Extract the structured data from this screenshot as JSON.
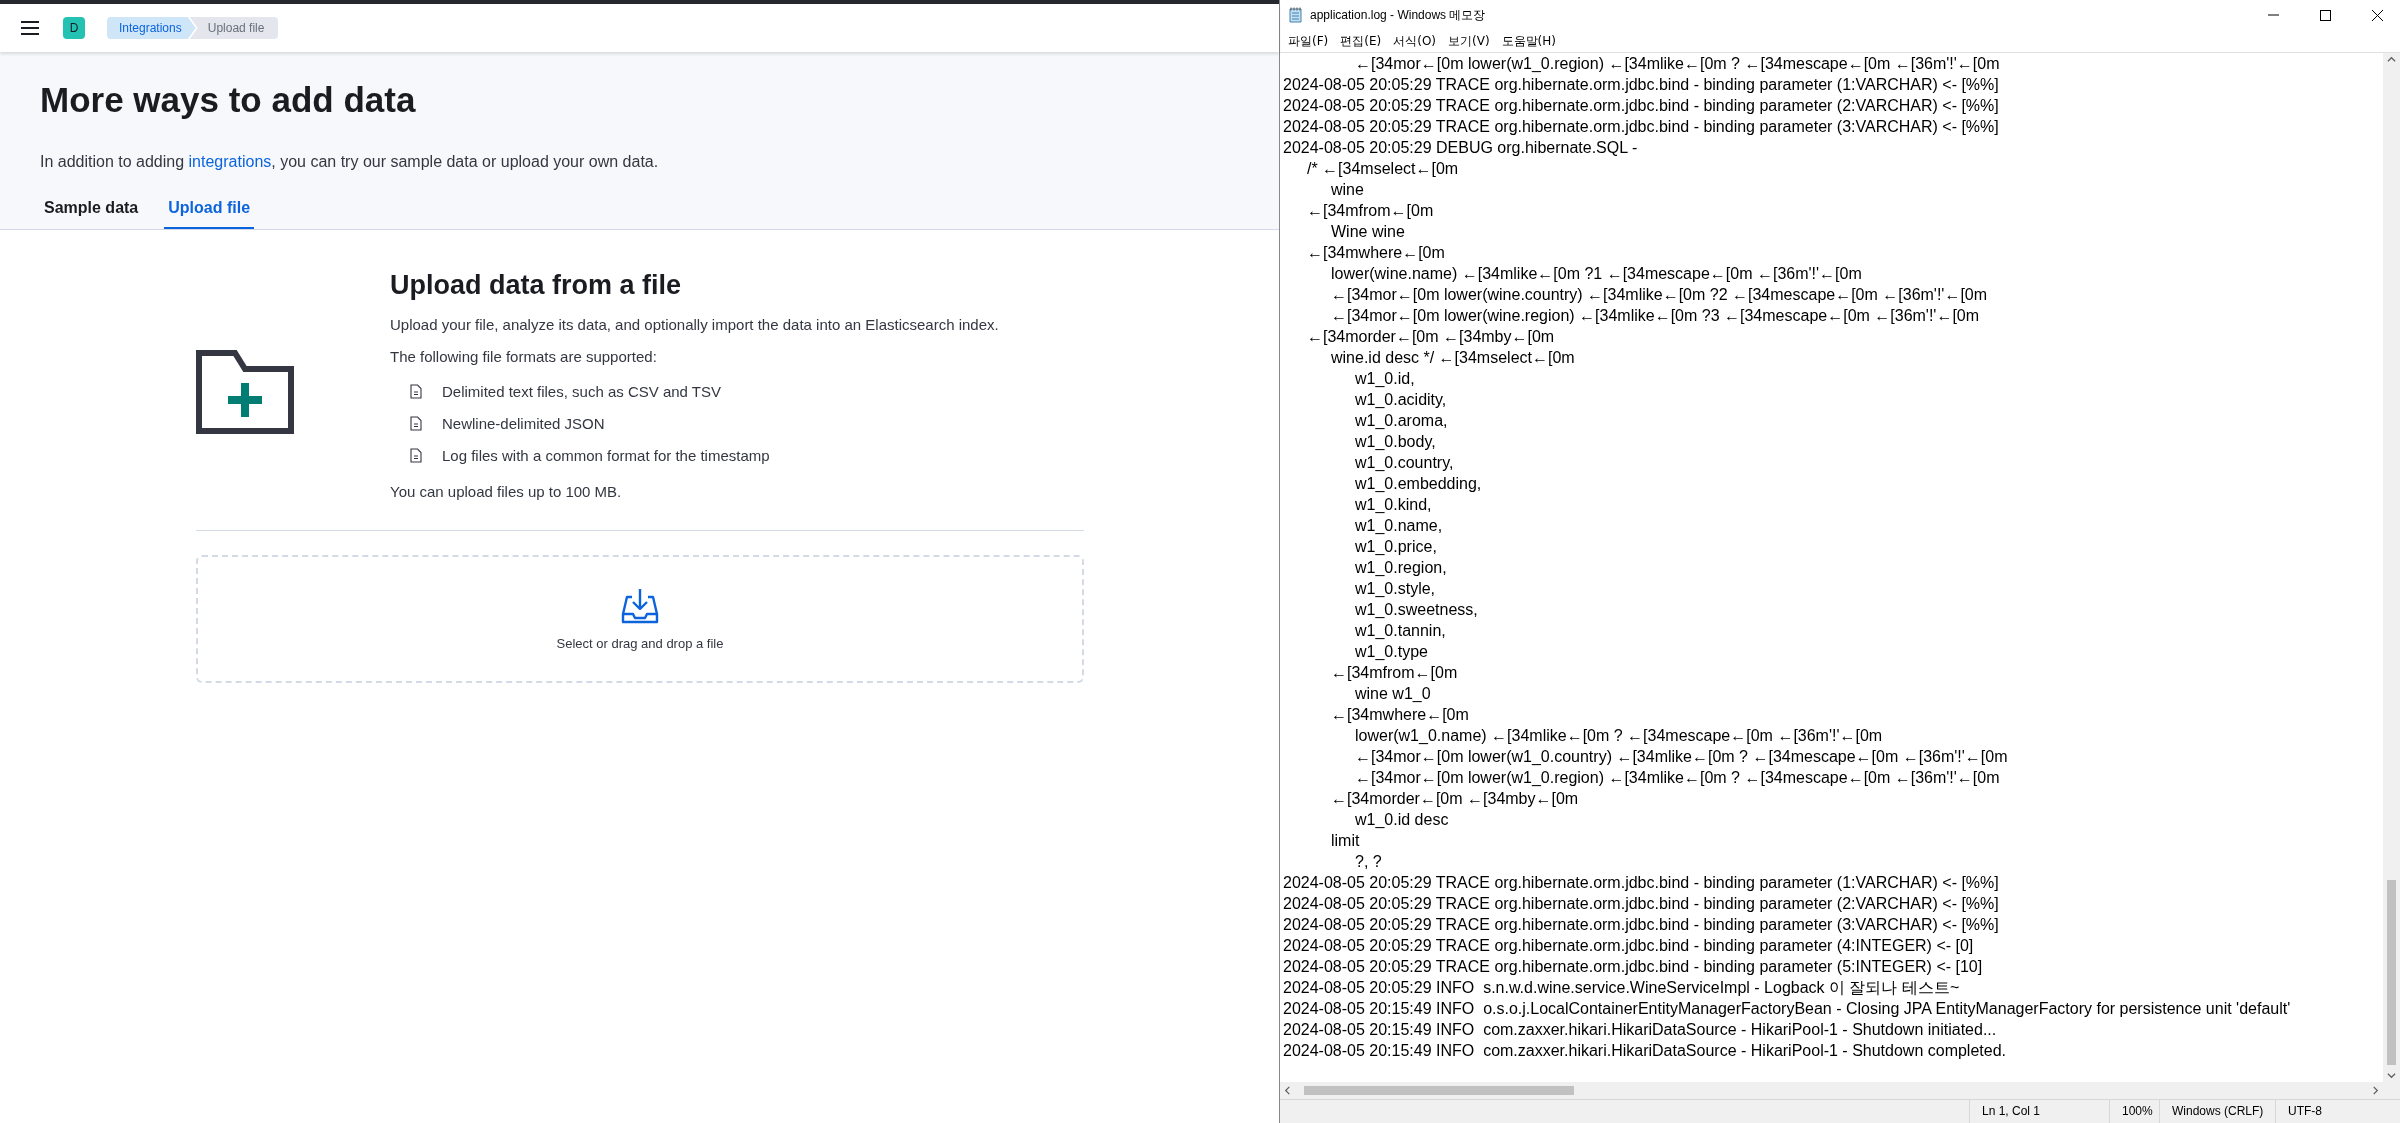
{
  "kibana": {
    "header": {
      "avatar": "D",
      "breadcrumbs": [
        {
          "label": "Integrations",
          "selected": false
        },
        {
          "label": "Upload file",
          "selected": true
        }
      ]
    },
    "page": {
      "title": "More ways to add data",
      "description": {
        "before": "In addition to adding ",
        "link": "integrations",
        "after": ", you can try our sample data or upload your own data."
      },
      "tabs": [
        {
          "label": "Sample data",
          "selected": false
        },
        {
          "label": "Upload file",
          "selected": true
        }
      ]
    },
    "upload": {
      "title": "Upload data from a file",
      "description": "Upload your file, analyze its data, and optionally import the data into an Elasticsearch index.",
      "formats_intro": "The following file formats are supported:",
      "formats": [
        "Delimited text files, such as CSV and TSV",
        "Newline-delimited JSON",
        "Log files with a common format for the timestamp"
      ],
      "limit": "You can upload files up to 100 MB.",
      "dropzone": "Select or drag and drop a file"
    }
  },
  "notepad": {
    "title": "application.log - Windows 메모장",
    "menu": [
      "파일(F)",
      "편집(E)",
      "서식(O)",
      "보기(V)",
      "도움말(H)"
    ],
    "lines": [
      "\t\t\t←[34mor←[0m lower(w1_0.region) ←[34mlike←[0m ? ←[34mescape←[0m ←[36m'!'←[0m",
      "2024-08-05 20:05:29 TRACE org.hibernate.orm.jdbc.bind - binding parameter (1:VARCHAR) <- [%%]",
      "2024-08-05 20:05:29 TRACE org.hibernate.orm.jdbc.bind - binding parameter (2:VARCHAR) <- [%%]",
      "2024-08-05 20:05:29 TRACE org.hibernate.orm.jdbc.bind - binding parameter (3:VARCHAR) <- [%%]",
      "2024-08-05 20:05:29 DEBUG org.hibernate.SQL -",
      "\t/* ←[34mselect←[0m",
      "\t\twine",
      "\t←[34mfrom←[0m",
      "\t\tWine wine",
      "\t←[34mwhere←[0m",
      "\t\tlower(wine.name) ←[34mlike←[0m ?1 ←[34mescape←[0m ←[36m'!'←[0m",
      "\t\t←[34mor←[0m lower(wine.country) ←[34mlike←[0m ?2 ←[34mescape←[0m ←[36m'!'←[0m",
      "\t\t←[34mor←[0m lower(wine.region) ←[34mlike←[0m ?3 ←[34mescape←[0m ←[36m'!'←[0m",
      "\t←[34morder←[0m ←[34mby←[0m",
      "\t\twine.id desc */ ←[34mselect←[0m",
      "\t\t\tw1_0.id,",
      "\t\t\tw1_0.acidity,",
      "\t\t\tw1_0.aroma,",
      "\t\t\tw1_0.body,",
      "\t\t\tw1_0.country,",
      "\t\t\tw1_0.embedding,",
      "\t\t\tw1_0.kind,",
      "\t\t\tw1_0.name,",
      "\t\t\tw1_0.price,",
      "\t\t\tw1_0.region,",
      "\t\t\tw1_0.style,",
      "\t\t\tw1_0.sweetness,",
      "\t\t\tw1_0.tannin,",
      "\t\t\tw1_0.type",
      "\t\t←[34mfrom←[0m",
      "\t\t\twine w1_0",
      "\t\t←[34mwhere←[0m",
      "\t\t\tlower(w1_0.name) ←[34mlike←[0m ? ←[34mescape←[0m ←[36m'!'←[0m",
      "\t\t\t←[34mor←[0m lower(w1_0.country) ←[34mlike←[0m ? ←[34mescape←[0m ←[36m'!'←[0m",
      "\t\t\t←[34mor←[0m lower(w1_0.region) ←[34mlike←[0m ? ←[34mescape←[0m ←[36m'!'←[0m",
      "\t\t←[34morder←[0m ←[34mby←[0m",
      "\t\t\tw1_0.id desc",
      "\t\tlimit",
      "\t\t\t?, ?",
      "2024-08-05 20:05:29 TRACE org.hibernate.orm.jdbc.bind - binding parameter (1:VARCHAR) <- [%%]",
      "2024-08-05 20:05:29 TRACE org.hibernate.orm.jdbc.bind - binding parameter (2:VARCHAR) <- [%%]",
      "2024-08-05 20:05:29 TRACE org.hibernate.orm.jdbc.bind - binding parameter (3:VARCHAR) <- [%%]",
      "2024-08-05 20:05:29 TRACE org.hibernate.orm.jdbc.bind - binding parameter (4:INTEGER) <- [0]",
      "2024-08-05 20:05:29 TRACE org.hibernate.orm.jdbc.bind - binding parameter (5:INTEGER) <- [10]",
      "2024-08-05 20:05:29 INFO  s.n.w.d.wine.service.WineServiceImpl - Logback 이 잘되나 테스트~",
      "2024-08-05 20:15:49 INFO  o.s.o.j.LocalContainerEntityManagerFactoryBean - Closing JPA EntityManagerFactory for persistence unit 'default'",
      "2024-08-05 20:15:49 INFO  com.zaxxer.hikari.HikariDataSource - HikariPool-1 - Shutdown initiated...",
      "2024-08-05 20:15:49 INFO  com.zaxxer.hikari.HikariDataSource - HikariPool-1 - Shutdown completed."
    ],
    "status_bar": {
      "position": "Ln 1, Col 1",
      "zoom": "100%",
      "line_ending": "Windows (CRLF)",
      "encoding": "UTF-8"
    }
  }
}
